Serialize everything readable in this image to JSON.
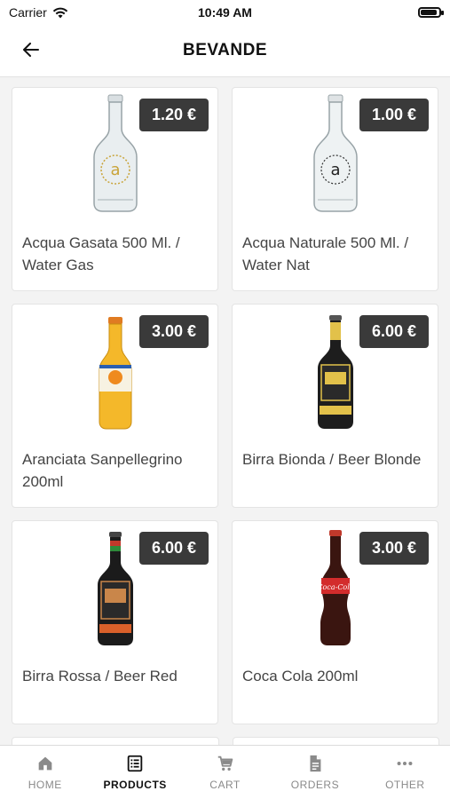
{
  "status": {
    "carrier": "Carrier",
    "time": "10:49 AM",
    "battery_level": 0.9
  },
  "nav": {
    "title": "BEVANDE"
  },
  "products": [
    {
      "name": "Acqua Gasata 500 Ml. / Water Gas",
      "price": "1.20 €",
      "bottle": "clear-bottle-gold"
    },
    {
      "name": "Acqua Naturale 500 Ml. / Water Nat",
      "price": "1.00 €",
      "bottle": "clear-bottle-black"
    },
    {
      "name": "Aranciata Sanpellegrino 200ml",
      "price": "3.00 €",
      "bottle": "orange-soda-bottle"
    },
    {
      "name": "Birra Bionda / Beer Blonde",
      "price": "6.00 €",
      "bottle": "blonde-beer-bottle"
    },
    {
      "name": "Birra Rossa / Beer Red",
      "price": "6.00 €",
      "bottle": "red-beer-bottle"
    },
    {
      "name": "Coca Cola 200ml",
      "price": "3.00 €",
      "bottle": "cola-bottle"
    }
  ],
  "tabs": [
    {
      "label": "HOME",
      "icon": "home-icon"
    },
    {
      "label": "PRODUCTS",
      "icon": "list-icon",
      "active": true
    },
    {
      "label": "CART",
      "icon": "cart-icon"
    },
    {
      "label": "ORDERS",
      "icon": "document-icon"
    },
    {
      "label": "OTHER",
      "icon": "more-icon"
    }
  ],
  "colors": {
    "price_badge": "#3a3a3a",
    "background": "#f3f3f3"
  }
}
